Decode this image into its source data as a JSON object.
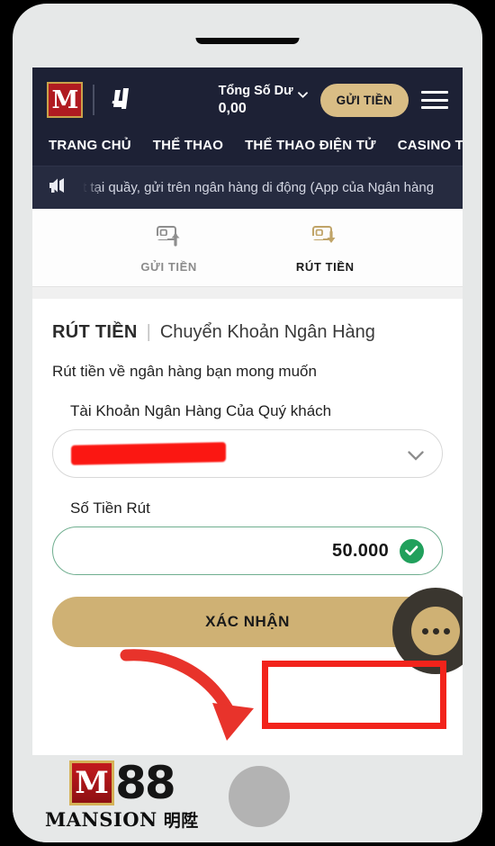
{
  "header": {
    "logo_primary": "M",
    "logo_secondary": "laliga-mark",
    "balance_label": "Tổng Số Dư",
    "balance_value": "0,00",
    "deposit_button": "GỬI TIỀN",
    "menu_icon": "hamburger-menu-icon"
  },
  "nav": {
    "items": [
      {
        "label": "TRANG CHỦ"
      },
      {
        "label": "THỂ THAO"
      },
      {
        "label": "THỂ THAO ĐIỆN TỬ"
      },
      {
        "label": "CASINO TRỰC T"
      }
    ]
  },
  "announcement": {
    "icon": "megaphone-icon",
    "text": "t tại quầy, gửi trên ngân hàng di động (App của Ngân hàng"
  },
  "tabs": [
    {
      "label": "GỬI TIỀN",
      "icon": "wallet-up-arrow-icon",
      "active": false
    },
    {
      "label": "RÚT TIỀN",
      "icon": "wallet-down-arrow-icon",
      "active": true
    }
  ],
  "form": {
    "title_strong": "RÚT TIỀN",
    "title_separator": "|",
    "title_light": "Chuyển Khoản Ngân Hàng",
    "subtitle": "Rút tiền về ngân hàng bạn mong muốn",
    "bank_account": {
      "label": "Tài Khoản Ngân Hàng Của Quý khách",
      "value": "",
      "redacted": true,
      "chevron_icon": "chevron-down-icon"
    },
    "amount": {
      "label": "Số Tiền Rút",
      "value": "50.000",
      "valid_icon": "check-circle-icon"
    },
    "confirm_button": "XÁC NHẬN",
    "fab_icon": "more-dots-icon"
  },
  "annotations": {
    "highlight_rect_color": "#f2231b",
    "arrow_color": "#e8332b",
    "redaction_color": "#fb1712"
  },
  "brand_footer": {
    "mark": "M",
    "number": "88",
    "word": "MANSION",
    "word_cn": "明陞"
  },
  "colors": {
    "header_bg": "#1d2135",
    "announce_bg": "#262b40",
    "gold": "#d9bd85",
    "button_gold": "#cfb174",
    "green_border": "#6fae8f",
    "check_green": "#21a05c",
    "red_accent": "#b01b21"
  }
}
